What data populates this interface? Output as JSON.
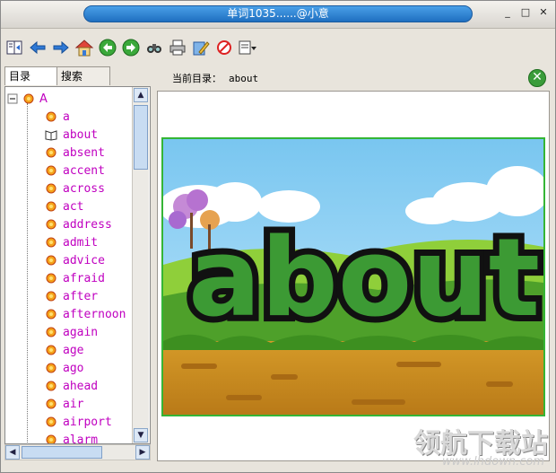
{
  "window": {
    "title": "单词1035......@小意"
  },
  "title_controls": {
    "minimize": "_",
    "maximize": "□",
    "close": "✕"
  },
  "toolbar": {
    "buttons": [
      {
        "name": "tree-toggle-icon"
      },
      {
        "name": "back-icon"
      },
      {
        "name": "forward-icon"
      },
      {
        "name": "home-icon"
      },
      {
        "name": "nav-back-circle-icon"
      },
      {
        "name": "nav-forward-circle-icon"
      },
      {
        "name": "find-icon"
      },
      {
        "name": "print-icon"
      },
      {
        "name": "edit-icon"
      },
      {
        "name": "stop-icon"
      },
      {
        "name": "options-icon"
      }
    ]
  },
  "tabs": [
    {
      "label": "目录"
    },
    {
      "label": "搜索"
    }
  ],
  "tree": {
    "root": "A",
    "items": [
      "a",
      "about",
      "absent",
      "accent",
      "across",
      "act",
      "address",
      "admit",
      "advice",
      "afraid",
      "after",
      "afternoon",
      "again",
      "age",
      "ago",
      "ahead",
      "air",
      "airport",
      "alarm"
    ],
    "selected": "about"
  },
  "path": {
    "label": "当前目录：",
    "value": "about"
  },
  "picture": {
    "word": "about"
  },
  "watermark": {
    "text": "领航下载站",
    "url": "www.lhdown.com"
  },
  "colors": {
    "accent": "#1f6fc0",
    "tree_text": "#c000c0",
    "frame_green": "#35b535"
  }
}
